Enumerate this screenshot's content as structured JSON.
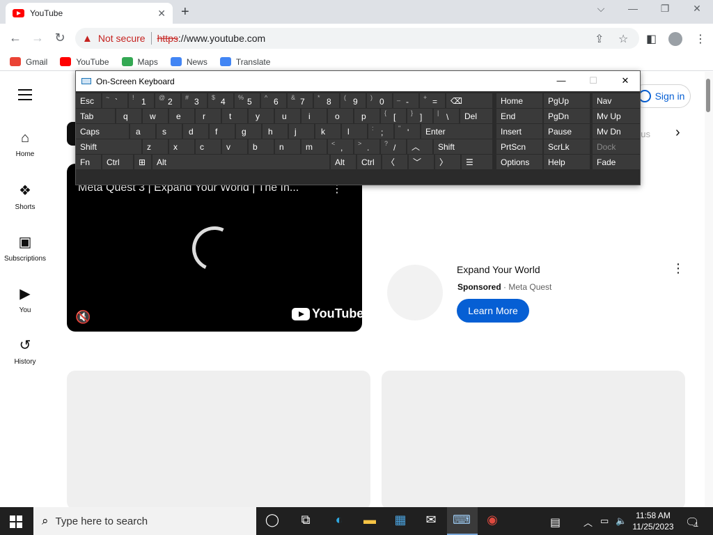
{
  "browser": {
    "tab_title": "YouTube",
    "tab_close": "✕",
    "new_tab": "+",
    "controls": {
      "chevron": "⌵",
      "minimize": "—",
      "restore": "❐",
      "close": "✕"
    },
    "security_label": "Not secure",
    "url_scheme": "https",
    "url_rest": "://www.youtube.com",
    "bookmarks": [
      {
        "label": "Gmail",
        "icon": "gmail-icon",
        "color": "#EA4335"
      },
      {
        "label": "YouTube",
        "icon": "youtube-icon",
        "color": "#FF0000"
      },
      {
        "label": "Maps",
        "icon": "maps-icon",
        "color": "#34A853"
      },
      {
        "label": "News",
        "icon": "news-icon",
        "color": "#4285F4"
      },
      {
        "label": "Translate",
        "icon": "translate-icon",
        "color": "#4285F4"
      }
    ]
  },
  "youtube": {
    "sign_in": "Sign in",
    "faded_chip": "nus",
    "guide": [
      {
        "label": "Home",
        "icon": "home-icon"
      },
      {
        "label": "Shorts",
        "icon": "shorts-icon"
      },
      {
        "label": "Subscriptions",
        "icon": "subscriptions-icon"
      },
      {
        "label": "You",
        "icon": "you-icon"
      },
      {
        "label": "History",
        "icon": "history-icon"
      }
    ],
    "video_title": "Meta Quest 3 | Expand Your World | The In...",
    "logo_text": "YouTube",
    "ad": {
      "title": "Expand Your World",
      "sponsored": "Sponsored",
      "separator": " · ",
      "advertiser": "Meta Quest",
      "cta": "Learn More"
    }
  },
  "osk": {
    "title": "On-Screen Keyboard",
    "keys": {
      "esc": "Esc",
      "backspace": "⌫",
      "home": "Home",
      "pgup": "PgUp",
      "nav": "Nav",
      "tab": "Tab",
      "del": "Del",
      "end": "End",
      "pgdn": "PgDn",
      "mvup": "Mv Up",
      "caps": "Caps",
      "enter": "Enter",
      "insert": "Insert",
      "pause": "Pause",
      "mvdn": "Mv Dn",
      "shift": "Shift",
      "prtscn": "PrtScn",
      "scrlk": "ScrLk",
      "dock": "Dock",
      "fn": "Fn",
      "ctrl": "Ctrl",
      "alt": "Alt",
      "options": "Options",
      "help": "Help",
      "fade": "Fade",
      "left": "〈",
      "down": "﹀",
      "right": "〉",
      "up": "︿"
    },
    "row1": [
      {
        "s": "~",
        "m": "`"
      },
      {
        "s": "!",
        "m": "1"
      },
      {
        "s": "@",
        "m": "2"
      },
      {
        "s": "#",
        "m": "3"
      },
      {
        "s": "$",
        "m": "4"
      },
      {
        "s": "%",
        "m": "5"
      },
      {
        "s": "^",
        "m": "6"
      },
      {
        "s": "&",
        "m": "7"
      },
      {
        "s": "*",
        "m": "8"
      },
      {
        "s": "(",
        "m": "9"
      },
      {
        "s": ")",
        "m": "0"
      },
      {
        "s": "_",
        "m": "-"
      },
      {
        "s": "+",
        "m": "="
      }
    ],
    "row2": [
      "q",
      "w",
      "e",
      "r",
      "t",
      "y",
      "u",
      "i",
      "o",
      "p"
    ],
    "row2_sym": [
      {
        "s": "{",
        "m": "["
      },
      {
        "s": "}",
        "m": "]"
      },
      {
        "s": "|",
        "m": "\\"
      }
    ],
    "row3": [
      "a",
      "s",
      "d",
      "f",
      "g",
      "h",
      "j",
      "k",
      "l"
    ],
    "row3_sym": [
      {
        "s": ":",
        "m": ";"
      },
      {
        "s": "\"",
        "m": "'"
      }
    ],
    "row4": [
      "z",
      "x",
      "c",
      "v",
      "b",
      "n",
      "m"
    ],
    "row4_sym": [
      {
        "s": "<",
        "m": ","
      },
      {
        "s": ">",
        "m": "."
      },
      {
        "s": "?",
        "m": "/"
      }
    ]
  },
  "taskbar": {
    "search_placeholder": "Type here to search",
    "time": "11:58 AM",
    "date": "11/25/2023",
    "notification_count": "1"
  }
}
